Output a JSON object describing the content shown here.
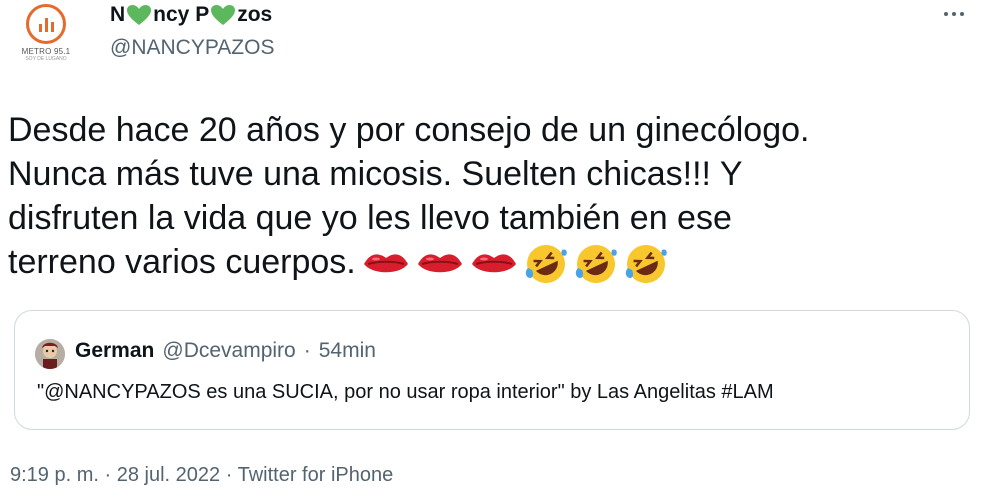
{
  "author": {
    "name_part1": "N",
    "name_part2": "ncy P",
    "name_part3": "zos",
    "handle": "@NANCYPAZOS",
    "avatar_text": "METRO 95.1",
    "avatar_subtext": "SOY DE LUGANO",
    "heart_color": "#5cb85c",
    "brand_color": "#e56a2b"
  },
  "menu": {
    "icon": "more-horizontal-icon"
  },
  "tweet": {
    "text": "Desde hace 20 años y por consejo de un ginecólogo.\nNunca más tuve una micosis. Suelten chicas!!! Y\ndisfruten la vida que yo les llevo también en ese\nterreno varios cuerpos.",
    "emojis": [
      "kiss-mark-icon",
      "kiss-mark-icon",
      "kiss-mark-icon",
      "rolling-laughing-icon",
      "rolling-laughing-icon",
      "rolling-laughing-icon"
    ]
  },
  "quote": {
    "name": "German",
    "handle": "@Dcevampiro",
    "separator": "·",
    "time": "54min",
    "text": "\"@NANCYPAZOS es una SUCIA, por no usar ropa interior\" by Las Angelitas #LAM"
  },
  "footer": {
    "time": "9:19 p. m.",
    "sep1": "·",
    "date": "28 jul. 2022",
    "sep2": "·",
    "source": "Twitter for iPhone"
  }
}
